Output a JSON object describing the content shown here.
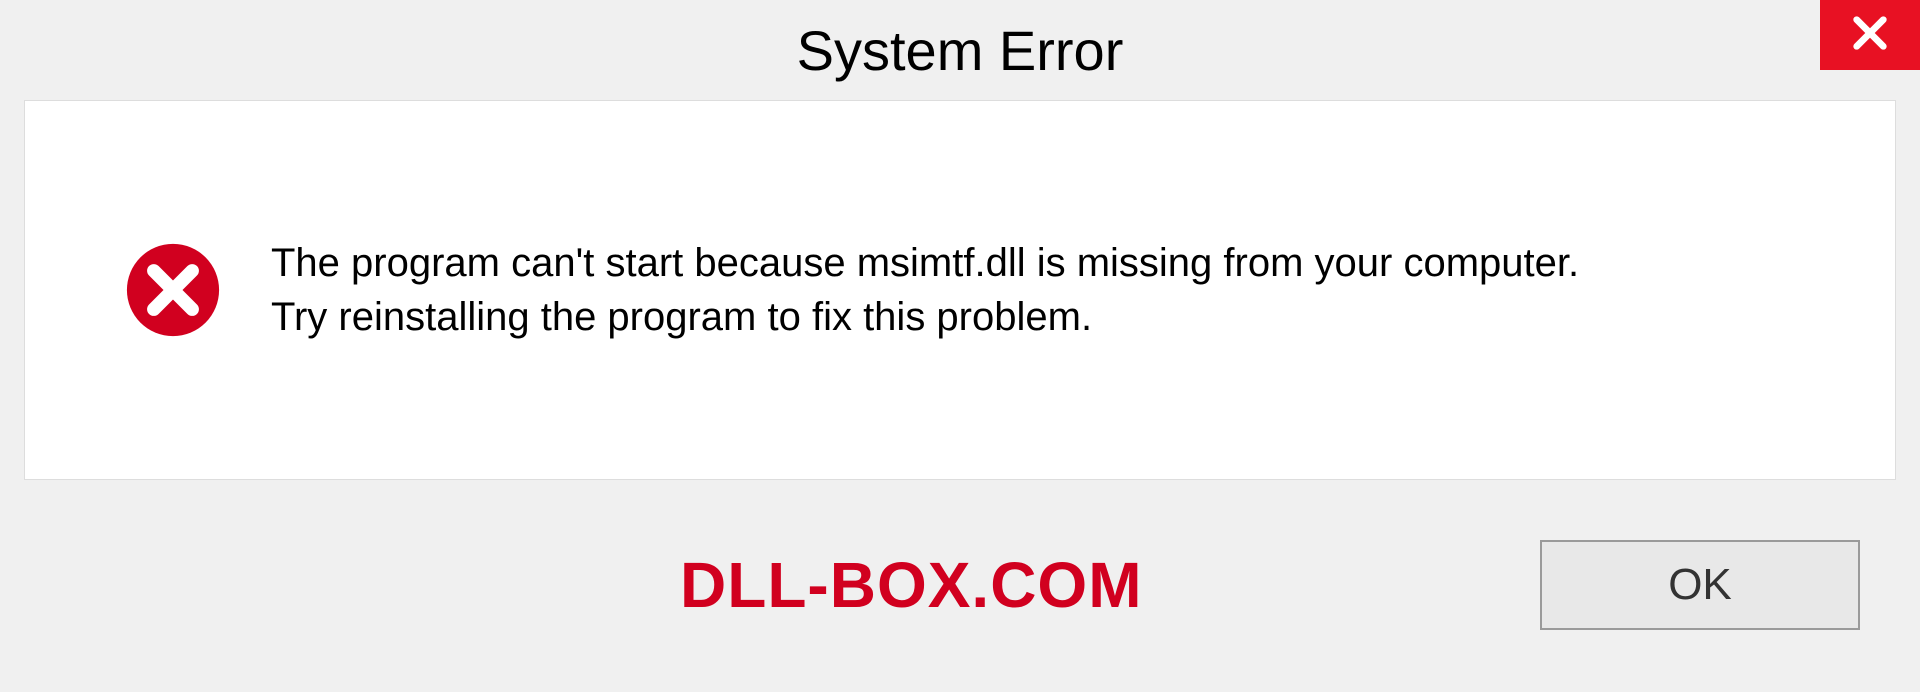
{
  "titlebar": {
    "title": "System Error"
  },
  "message": {
    "line1": "The program can't start because msimtf.dll is missing from your computer.",
    "line2": "Try reinstalling the program to fix this problem."
  },
  "footer": {
    "watermark": "DLL-BOX.COM",
    "ok_label": "OK"
  },
  "colors": {
    "close_bg": "#e81123",
    "error_icon": "#d1001f",
    "watermark": "#d1001f"
  }
}
